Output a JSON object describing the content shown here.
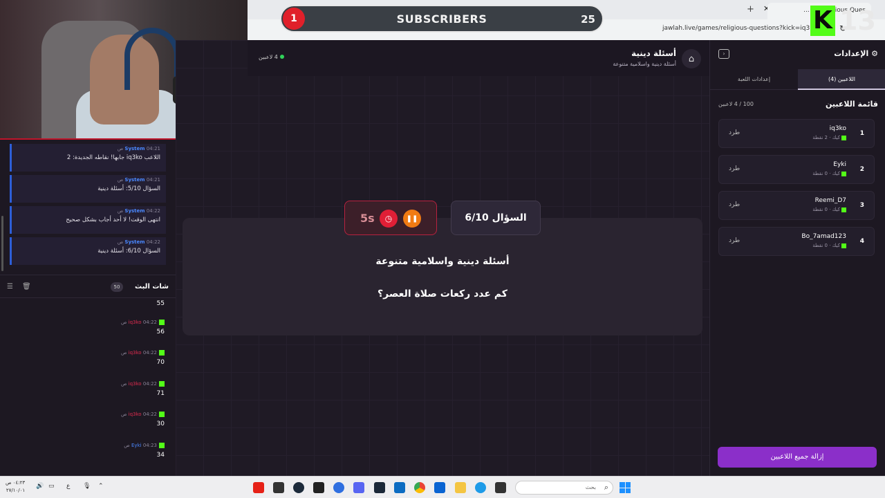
{
  "browser": {
    "tab_title": "ligious Ques أسئلة ...",
    "url": "jawlah.live/games/religious-questions?kick=iq3ko",
    "new_tab": "+",
    "close_tab": "✕"
  },
  "overlay": {
    "subscribers_label": "SUBSCRIBERS",
    "subscribers_current": "1",
    "subscribers_goal": "25",
    "kick_count": "13",
    "kick_letter": "K"
  },
  "stream_chat": {
    "system_messages": [
      {
        "name": "System",
        "time": "04:21 ص",
        "text": "اللاعب iq3ko جابها! نقاطه الجديدة: 2"
      },
      {
        "name": "System",
        "time": "04:21 ص",
        "text": "السؤال 5/10: أسئلة دينية"
      },
      {
        "name": "System",
        "time": "04:22 ص",
        "text": "انتهى الوقت! لا أحد أجاب بشكل صحيح"
      },
      {
        "name": "System",
        "time": "04:22 ص",
        "text": "السؤال 6/10: أسئلة دينية"
      }
    ],
    "title": "شات البث",
    "count": "50",
    "messages": [
      {
        "user": "",
        "time": "",
        "text": "55"
      },
      {
        "user": "iq3ko",
        "time": "04:22 ص",
        "text": "56"
      },
      {
        "user": "iq3ko",
        "time": "04:22 ص",
        "text": "70"
      },
      {
        "user": "iq3ko",
        "time": "04:22 ص",
        "text": "71"
      },
      {
        "user": "iq3ko",
        "time": "04:22 ص",
        "text": "30"
      },
      {
        "user": "Eyki",
        "time": "04:23 ص",
        "text": "34"
      }
    ]
  },
  "game": {
    "title": "أسئلة دينية",
    "subtitle": "أسئلة دينية واسلامية متنوعة",
    "players_online": "4 لاعبين",
    "timer": "5s",
    "question_number": "السؤال 6/10",
    "category": "أسئلة دينية واسلامية متنوعة",
    "question": "كم عدد ركعات صلاة العصر؟"
  },
  "sidebar": {
    "title": "الإعدادات",
    "tabs": [
      "اللاعبين (4)",
      "إعدادات اللعبة"
    ],
    "players_title": "قائمة اللاعبين",
    "players_count": "100 / 4 لاعبين",
    "kick_label": "طرد",
    "players": [
      {
        "rank": "1",
        "name": "iq3ko",
        "meta": "كيك · 2 نقطة"
      },
      {
        "rank": "2",
        "name": "Eyki",
        "meta": "كيك · 0 نقطة"
      },
      {
        "rank": "3",
        "name": "Reemi_D7",
        "meta": "كيك · 0 نقطة"
      },
      {
        "rank": "4",
        "name": "Bo_7amad123",
        "meta": "كيك · 0 نقطة"
      }
    ],
    "remove_all": "إزالة جميع اللاعبين"
  },
  "taskbar": {
    "time": "٠٤:٢٣ ص",
    "date": "٢٧/١٠/٠١",
    "lang": "ع",
    "search_placeholder": "بحث"
  },
  "colors": {
    "accent_purple": "#8b2fc9",
    "kick_green": "#53fc18",
    "timer_red": "#e01f36",
    "pause_orange": "#f07b13",
    "system_blue": "#4a88ff"
  }
}
